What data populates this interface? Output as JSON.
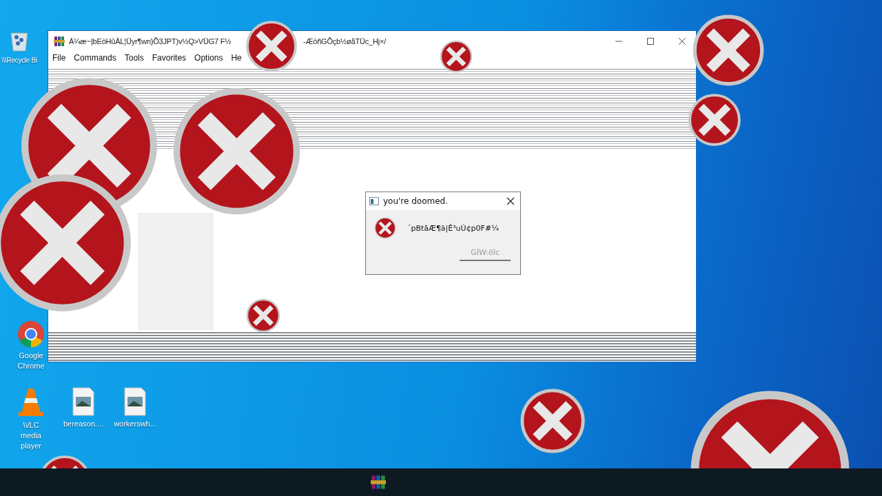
{
  "desktop_icons": [
    {
      "label": "\\\\\\Recycle Bi",
      "kind": "recycle"
    },
    {
      "label": "Google Chrome",
      "kind": "chrome"
    },
    {
      "label": "\\\\/LC media player",
      "kind": "vlc"
    },
    {
      "label": "bereason....",
      "kind": "image"
    },
    {
      "label": "workerswh...",
      "kind": "image"
    }
  ],
  "window": {
    "title_parts": [
      "Á¼æ~|bEöHûÂL¦Üyr¶wn)Õ3JPT)v½Q>VÜG7 F½",
      "-ÆöñGÕçb½øåTÜc_Hj×/"
    ],
    "menu": [
      "File",
      "Commands",
      "Tools",
      "Favorites",
      "Options",
      "He"
    ]
  },
  "dialog": {
    "title": "you're doomed.",
    "message": "´pBtâÆ¶ã|Ê³uÚ¢p0F#¼",
    "button": {
      "label": "GÍW:öîc",
      "disabled": true
    }
  }
}
